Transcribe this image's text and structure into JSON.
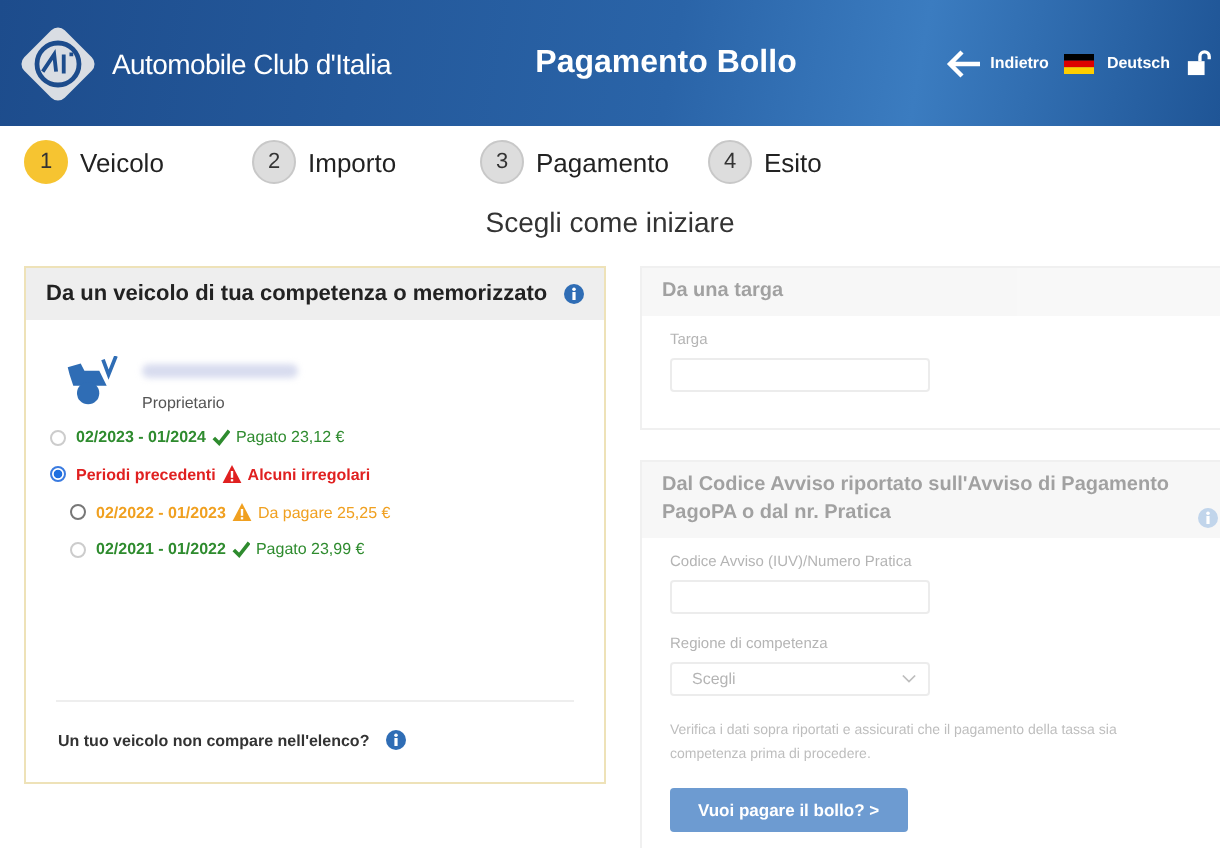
{
  "header": {
    "brand": "Automobile Club d'Italia",
    "title": "Pagamento Bollo",
    "back": "Indietro",
    "language": "Deutsch"
  },
  "steps": [
    {
      "number": "1",
      "label": "Veicolo",
      "selected": true
    },
    {
      "number": "2",
      "label": "Importo",
      "selected": false
    },
    {
      "number": "3",
      "label": "Pagamento",
      "selected": false
    },
    {
      "number": "4",
      "label": "Esito",
      "selected": false
    }
  ],
  "subtitle": "Scegli come iniziare",
  "vehicle_panel": {
    "title": "Da un veicolo di tua competenza o memorizzato",
    "role": "Proprietario",
    "periods": [
      {
        "range": "02/2023 - 01/2024",
        "status": "Pagato 23,12 €",
        "kind": "paid",
        "selected": false,
        "disabled": true
      },
      {
        "range": "Periodi precedenti",
        "status": "Alcuni irregolari",
        "kind": "irregular",
        "selected": true,
        "disabled": false,
        "children": [
          {
            "range": "02/2022 - 01/2023",
            "status": "Da pagare 25,25 €",
            "kind": "due",
            "selected": false,
            "disabled": false
          },
          {
            "range": "02/2021 - 01/2022",
            "status": "Pagato 23,99 €",
            "kind": "paid",
            "selected": false,
            "disabled": true
          }
        ]
      }
    ],
    "footer": "Un tuo veicolo non compare nell'elenco?"
  },
  "plate_panel": {
    "title": "Da una targa",
    "disabled": true,
    "field_label": "Targa"
  },
  "notice_panel": {
    "title": "Dal Codice Avviso riportato sull'Avviso di Pagamento PagoPA o dal nr. Pratica",
    "disabled": true,
    "code_label": "Codice Avviso (IUV)/Numero Pratica",
    "region_label": "Regione di competenza",
    "region_value": "Scegli",
    "note": [
      "Verifica i dati sopra riportati e assicurati che il pagamento della tassa sia",
      "competenza prima di procedere."
    ],
    "button": "Vuoi pagare il bollo? >"
  }
}
